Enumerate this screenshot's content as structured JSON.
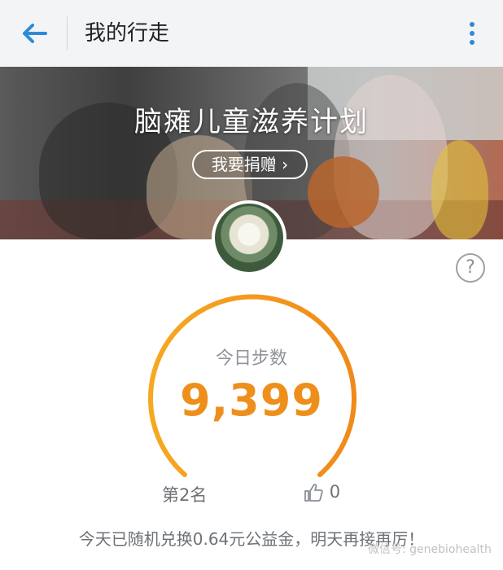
{
  "header": {
    "title": "我的行走",
    "back_icon": "arrow-left-icon",
    "more_icon": "more-vertical-icon",
    "accent_color": "#2c8ad8"
  },
  "banner": {
    "title": "脑瘫儿童滋养计划",
    "donate_label": "我要捐赠 ›"
  },
  "help_glyph": "?",
  "stats": {
    "steps_label": "今日步数",
    "steps_value": "9,399",
    "rank": "第2名",
    "likes": "0",
    "gauge_color": "#f59a1b"
  },
  "footer": {
    "note": "今天已随机兑换0.64元公益金，明天再接再厉！",
    "watermark": "微信号: genebiohealth"
  }
}
